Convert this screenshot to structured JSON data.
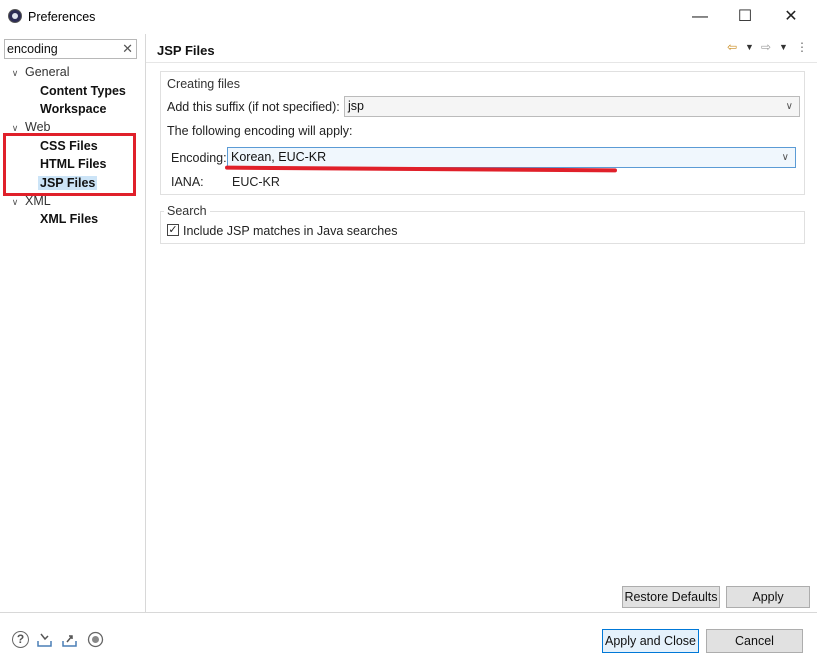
{
  "window": {
    "title": "Preferences",
    "minimize_glyph": "—",
    "maximize_glyph": "☐",
    "close_glyph": "✕"
  },
  "filter": {
    "value": "encoding",
    "clear_glyph": "✕"
  },
  "tree": {
    "categories": [
      {
        "label": "General",
        "children": [
          "Content Types",
          "Workspace"
        ]
      },
      {
        "label": "Web",
        "children": [
          "CSS Files",
          "HTML Files",
          "JSP Files"
        ]
      },
      {
        "label": "XML",
        "children": [
          "XML Files"
        ]
      }
    ],
    "selected": "JSP Files",
    "expand_glyph": "∨"
  },
  "page": {
    "title": "JSP Files",
    "back_glyph": "⇦",
    "forward_glyph": "⇨",
    "menu_glyph": "⋮"
  },
  "creating": {
    "group_label": "Creating files",
    "suffix_label": "Add this suffix (if not specified):",
    "suffix_value": "jsp",
    "encoding_intro": "The following encoding will apply:",
    "encoding_label": "Encoding:",
    "encoding_value": "Korean, EUC-KR",
    "iana_label": "IANA:",
    "iana_value": "EUC-KR"
  },
  "search": {
    "group_label": "Search",
    "checkbox_label": "Include JSP matches in Java searches",
    "checked": true
  },
  "buttons": {
    "restore_defaults": "Restore Defaults",
    "apply": "Apply",
    "apply_and_close": "Apply and Close",
    "cancel": "Cancel"
  },
  "colors": {
    "highlight": "#e0202a",
    "selection": "#cce4f7",
    "focus_border": "#5b9bd5"
  },
  "bottom_icons": [
    "help-icon",
    "import-icon",
    "export-icon",
    "record-icon"
  ]
}
